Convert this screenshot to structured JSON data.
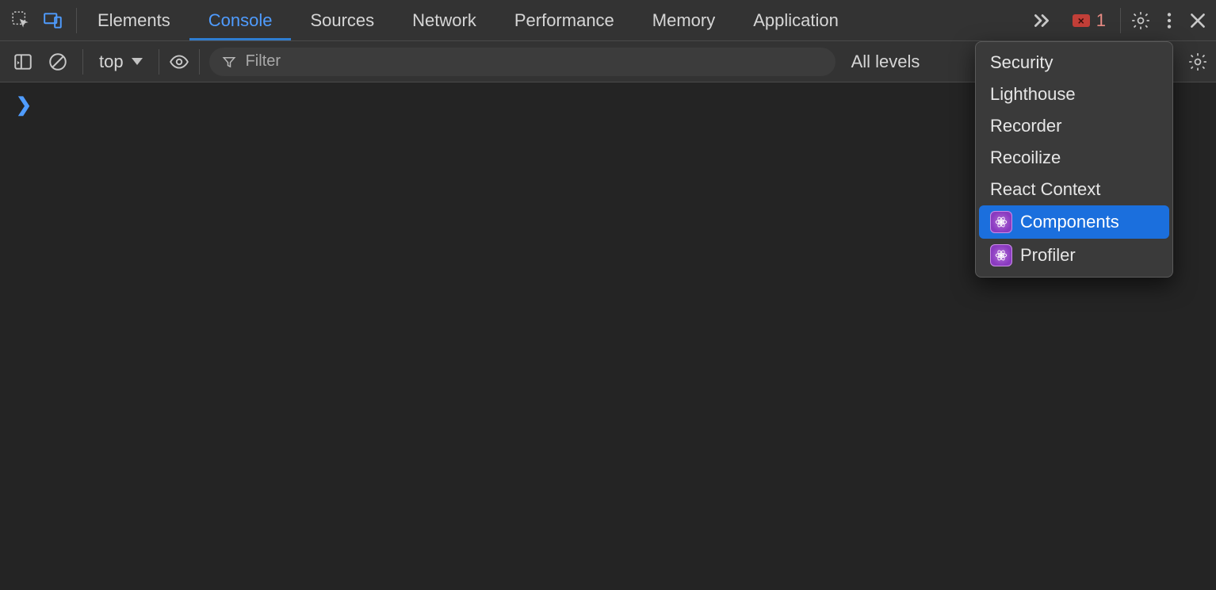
{
  "tabs": {
    "items": [
      {
        "label": "Elements"
      },
      {
        "label": "Console"
      },
      {
        "label": "Sources"
      },
      {
        "label": "Network"
      },
      {
        "label": "Performance"
      },
      {
        "label": "Memory"
      },
      {
        "label": "Application"
      }
    ],
    "active_index": 1
  },
  "errors": {
    "count": "1"
  },
  "console_toolbar": {
    "context": "top",
    "filter_placeholder": "Filter",
    "levels_label": "All levels"
  },
  "overflow_menu": {
    "items": [
      {
        "label": "Security",
        "icon": null
      },
      {
        "label": "Lighthouse",
        "icon": null
      },
      {
        "label": "Recorder",
        "icon": null
      },
      {
        "label": "Recoilize",
        "icon": null
      },
      {
        "label": "React Context",
        "icon": null
      },
      {
        "label": "Components",
        "icon": "react"
      },
      {
        "label": "Profiler",
        "icon": "react"
      }
    ],
    "selected_index": 5
  }
}
